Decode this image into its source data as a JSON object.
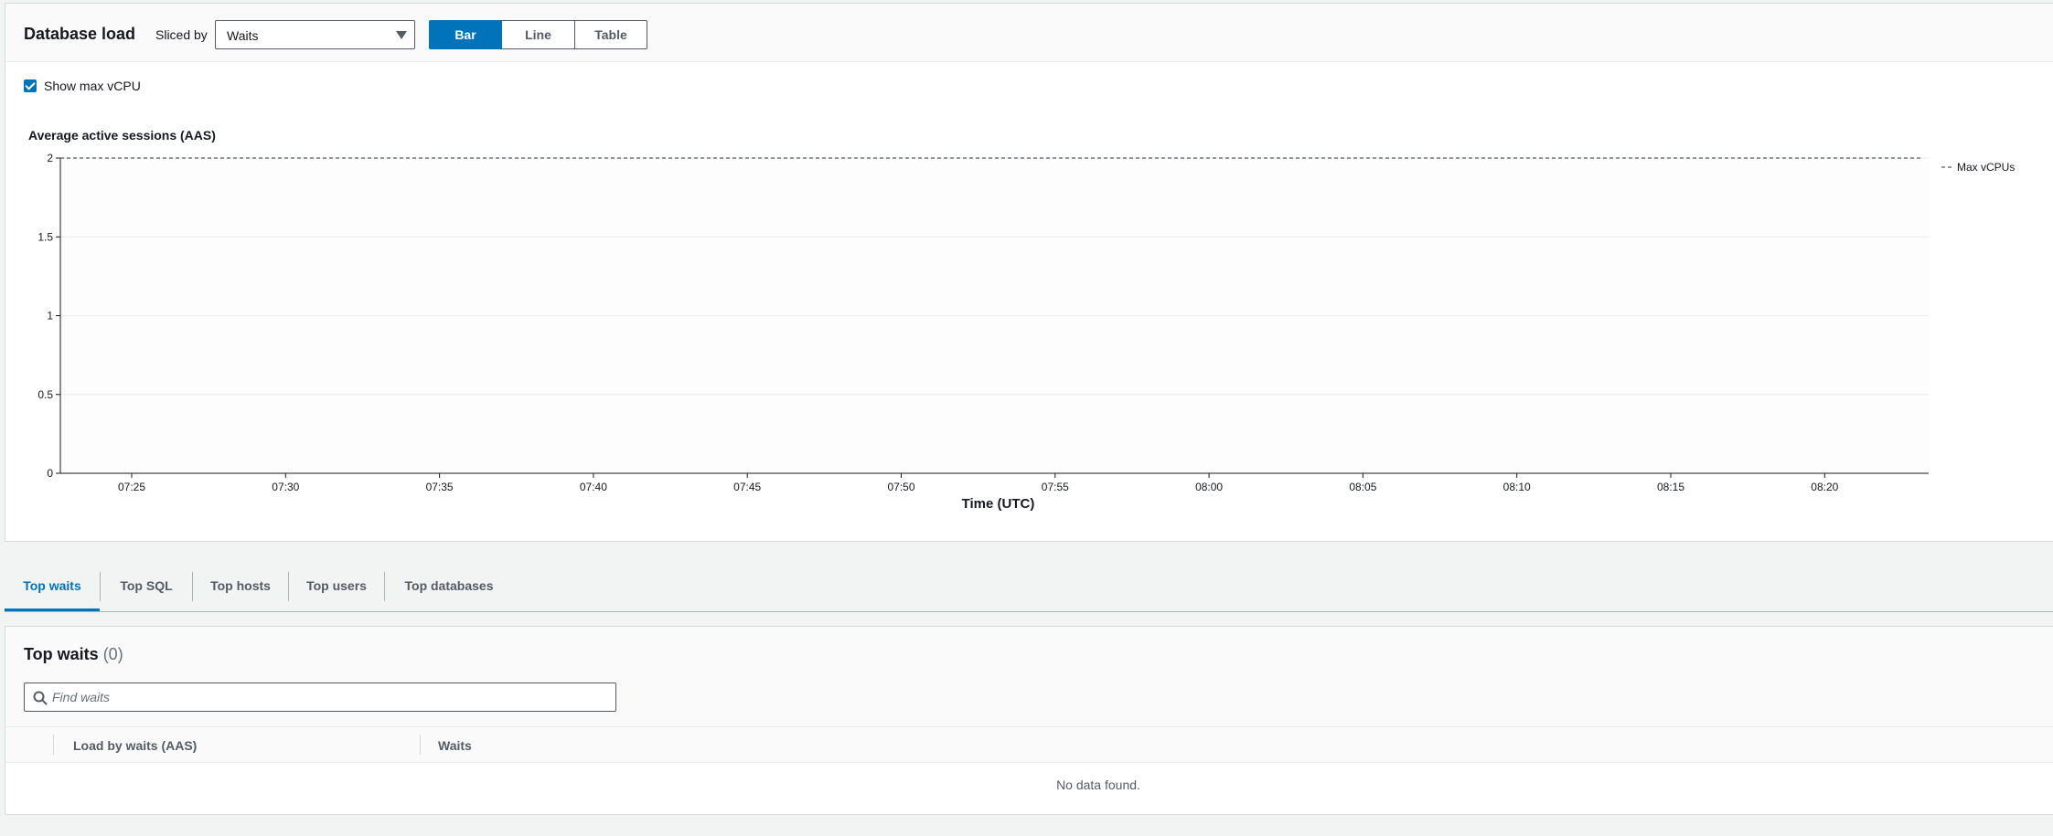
{
  "header": {
    "title": "Database load",
    "sliced_by_label": "Sliced by",
    "sliced_by_value": "Waits",
    "view_toggle": [
      "Bar",
      "Line",
      "Table"
    ],
    "active_view": "Bar"
  },
  "options": {
    "show_max_vcpu_label": "Show max vCPU",
    "show_max_vcpu_checked": true
  },
  "chart_data": {
    "type": "bar",
    "title": "Average active sessions (AAS)",
    "xlabel": "Time (UTC)",
    "ylabel": "",
    "x_ticks": [
      "07:25",
      "07:30",
      "07:35",
      "07:40",
      "07:45",
      "07:50",
      "07:55",
      "08:00",
      "08:05",
      "08:10",
      "08:15",
      "08:20"
    ],
    "y_ticks": [
      "0",
      "0.5",
      "1",
      "1.5",
      "2"
    ],
    "ylim": [
      0,
      2
    ],
    "grid": true,
    "series": [],
    "reference_lines": [
      {
        "name": "Max vCPUs",
        "value": 2,
        "style": "dashed",
        "color": "#545b64"
      }
    ],
    "legend": {
      "position": "right",
      "entries": [
        "Max vCPUs"
      ]
    }
  },
  "tabs": [
    {
      "label": "Top waits",
      "active": true
    },
    {
      "label": "Top SQL",
      "active": false
    },
    {
      "label": "Top hosts",
      "active": false
    },
    {
      "label": "Top users",
      "active": false
    },
    {
      "label": "Top databases",
      "active": false
    }
  ],
  "waits": {
    "title": "Top waits",
    "count": "(0)",
    "search_placeholder": "Find waits",
    "columns": [
      "Load by waits (AAS)",
      "Waits"
    ],
    "empty_message": "No data found."
  },
  "colors": {
    "accent": "#0073bb",
    "text": "#16191f",
    "grid": "#eaeded"
  }
}
